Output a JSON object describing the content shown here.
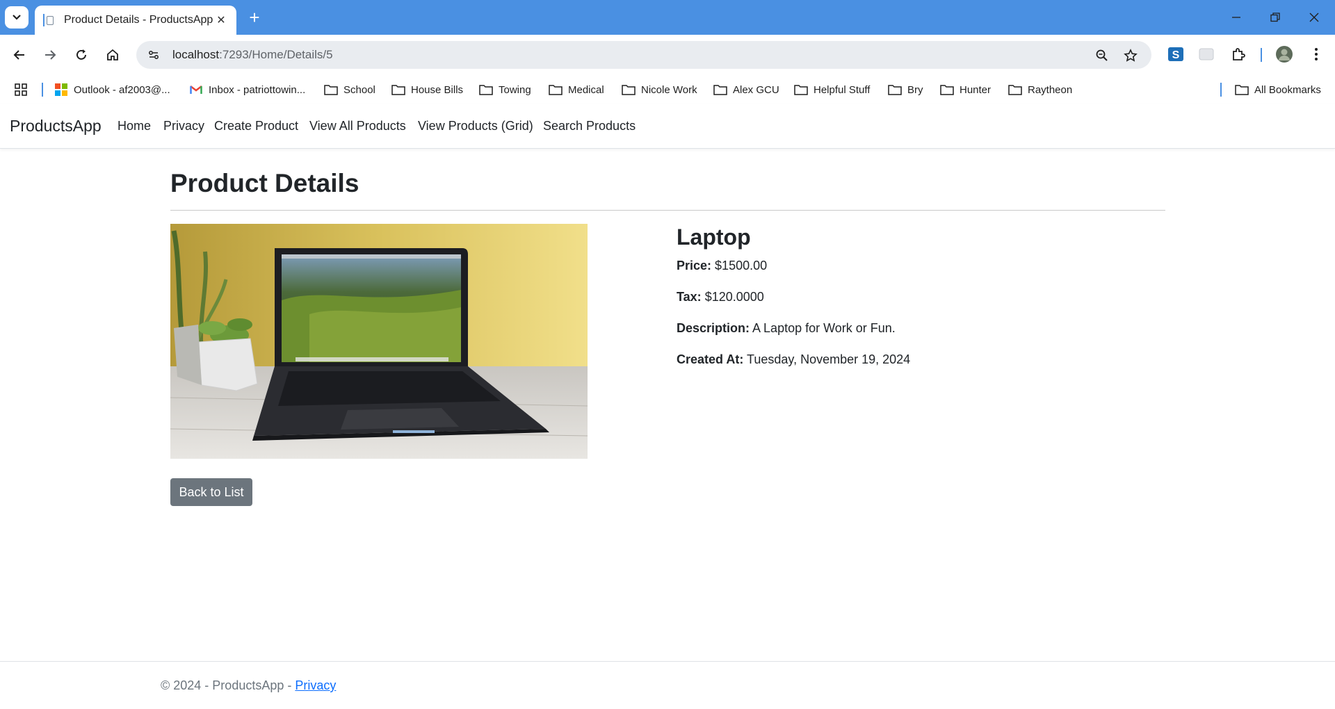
{
  "browser": {
    "tab_title": "Product Details - ProductsApp",
    "url_host": "localhost",
    "url_rest": ":7293/Home/Details/5",
    "bookmarks": [
      {
        "label": "Outlook - af2003@...",
        "icon": "microsoft-icon"
      },
      {
        "label": "Inbox - patriottowin...",
        "icon": "gmail-icon"
      },
      {
        "label": "School",
        "icon": "folder-icon"
      },
      {
        "label": "House Bills",
        "icon": "folder-icon"
      },
      {
        "label": "Towing",
        "icon": "folder-icon"
      },
      {
        "label": "Medical",
        "icon": "folder-icon"
      },
      {
        "label": "Nicole Work",
        "icon": "folder-icon"
      },
      {
        "label": "Alex GCU",
        "icon": "folder-icon"
      },
      {
        "label": "Helpful Stuff",
        "icon": "folder-icon"
      },
      {
        "label": "Bry",
        "icon": "folder-icon"
      },
      {
        "label": "Hunter",
        "icon": "folder-icon"
      },
      {
        "label": "Raytheon",
        "icon": "folder-icon"
      }
    ],
    "all_bookmarks": "All Bookmarks",
    "accent_color": "#4a90e2"
  },
  "site": {
    "brand": "ProductsApp",
    "nav": [
      "Home",
      "Privacy",
      "Create Product",
      "View All Products",
      "View Products (Grid)",
      "Search Products"
    ]
  },
  "page": {
    "title": "Product Details",
    "product_name": "Laptop",
    "price_label": "Price:",
    "price": "$1500.00",
    "tax_label": "Tax:",
    "tax": "$120.0000",
    "description_label": "Description:",
    "description": "A Laptop for Work or Fun.",
    "created_label": "Created At:",
    "created": "Tuesday, November 19, 2024",
    "back_button": "Back to List",
    "button_color": "#6c757d"
  },
  "footer": {
    "text": "© 2024 - ProductsApp - ",
    "privacy_link": "Privacy"
  }
}
